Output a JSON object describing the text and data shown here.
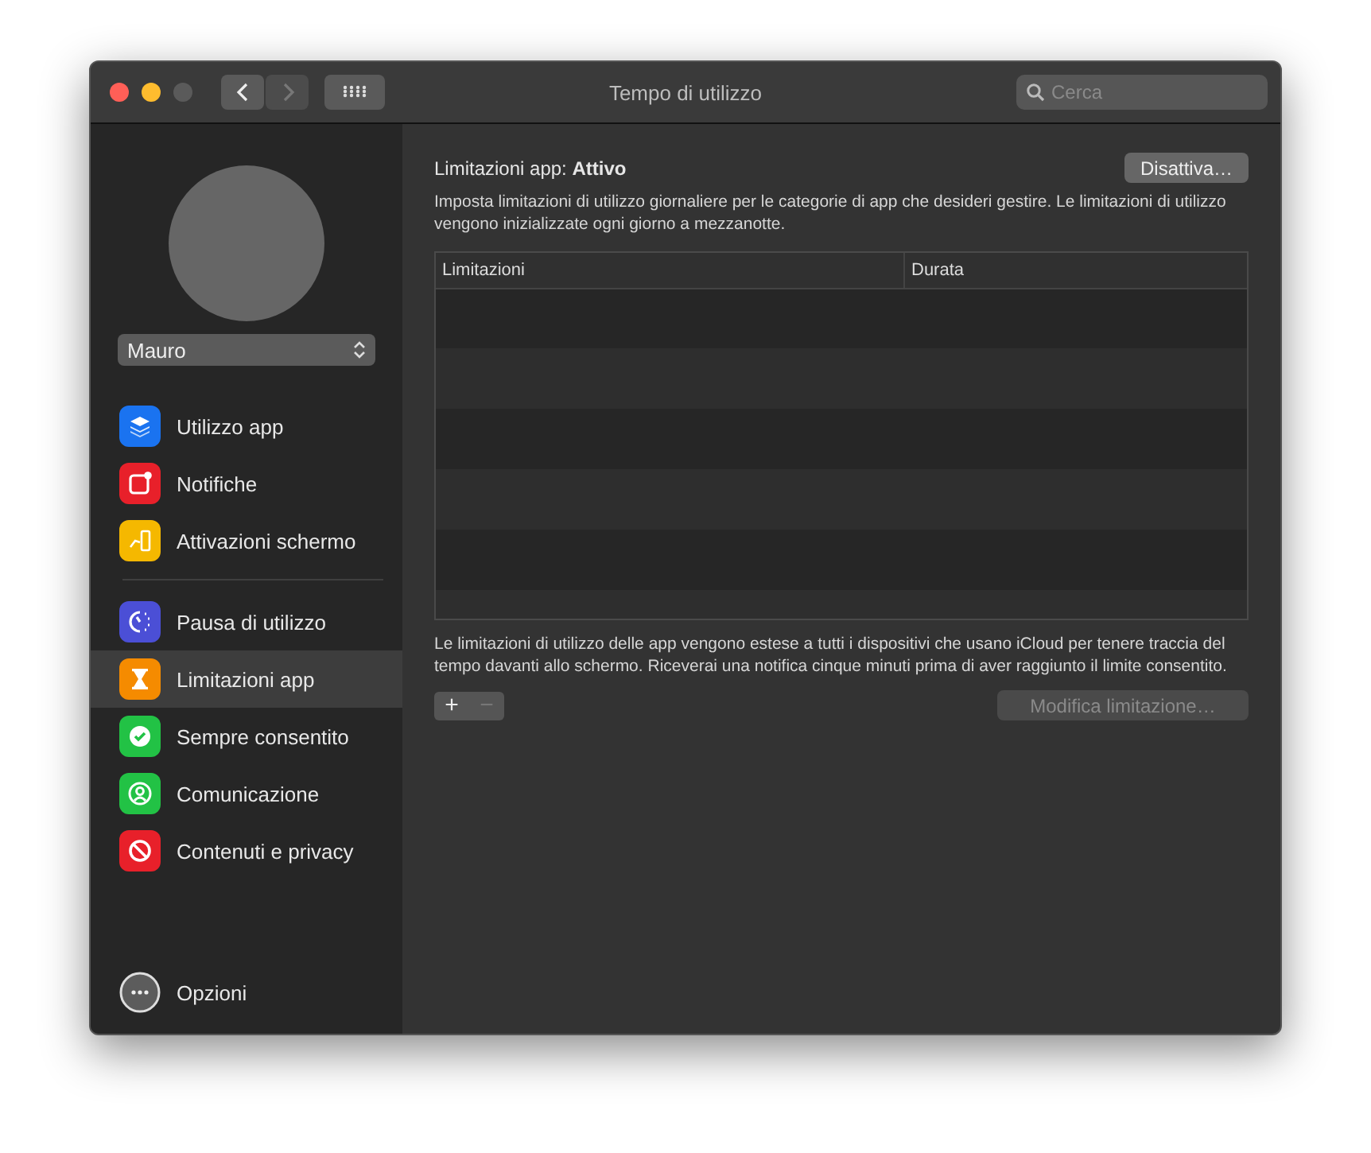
{
  "window": {
    "title": "Tempo di utilizzo",
    "controls": [
      {
        "kind": "close",
        "disabled": false
      },
      {
        "kind": "minimize",
        "disabled": false
      },
      {
        "kind": "zoom",
        "disabled": true
      }
    ]
  },
  "toolbar": {
    "back": {
      "disabled": false
    },
    "forward": {
      "disabled": true
    },
    "search": {
      "placeholder": "Cerca"
    }
  },
  "sidebar": {
    "user": "Mauro",
    "groups": [
      [
        {
          "label": "Utilizzo app",
          "kind": "layers",
          "color": "#1a73f0",
          "selected": false
        },
        {
          "label": "Notifiche",
          "kind": "notification",
          "color": "#e8202a",
          "selected": false
        },
        {
          "label": "Attivazioni schermo",
          "kind": "pickup",
          "color": "#f5b800",
          "selected": false
        }
      ],
      [
        {
          "label": "Pausa di utilizzo",
          "kind": "downtime",
          "color": "#4b4fd6",
          "selected": false
        },
        {
          "label": "Limitazioni app",
          "kind": "hourglass",
          "color": "#f58b00",
          "selected": true
        },
        {
          "label": "Sempre consentito",
          "kind": "check",
          "color": "#22c245",
          "selected": false
        },
        {
          "label": "Comunicazione",
          "kind": "person",
          "color": "#22c245",
          "selected": false
        },
        {
          "label": "Contenuti e privacy",
          "kind": "ban",
          "color": "#e8202a",
          "selected": false
        }
      ]
    ],
    "options": "Opzioni"
  },
  "content": {
    "heading": "Limitazioni app: **Attivo**",
    "toggle_button": "Disattiva…",
    "description": "Imposta limitazioni di utilizzo giornaliere per le categorie di app che desideri gestire. Le limitazioni di utilizzo vengono inizializzate ogni giorno a mezzanotte.",
    "table": {
      "columns": [
        "Limitazioni",
        "Durata"
      ]
    },
    "note": "Le limitazioni di utilizzo delle app vengono estese a tutti i dispositivi che usano iCloud per tenere traccia del tempo davanti allo schermo. Riceverai una notifica cinque minuti prima di aver raggiunto il limite consentito.",
    "add_button": {
      "label": "+",
      "disabled": false
    },
    "remove_button": {
      "label": "−",
      "disabled": true
    },
    "edit_button": {
      "label": "Modifica limitazione…",
      "disabled": true
    }
  }
}
